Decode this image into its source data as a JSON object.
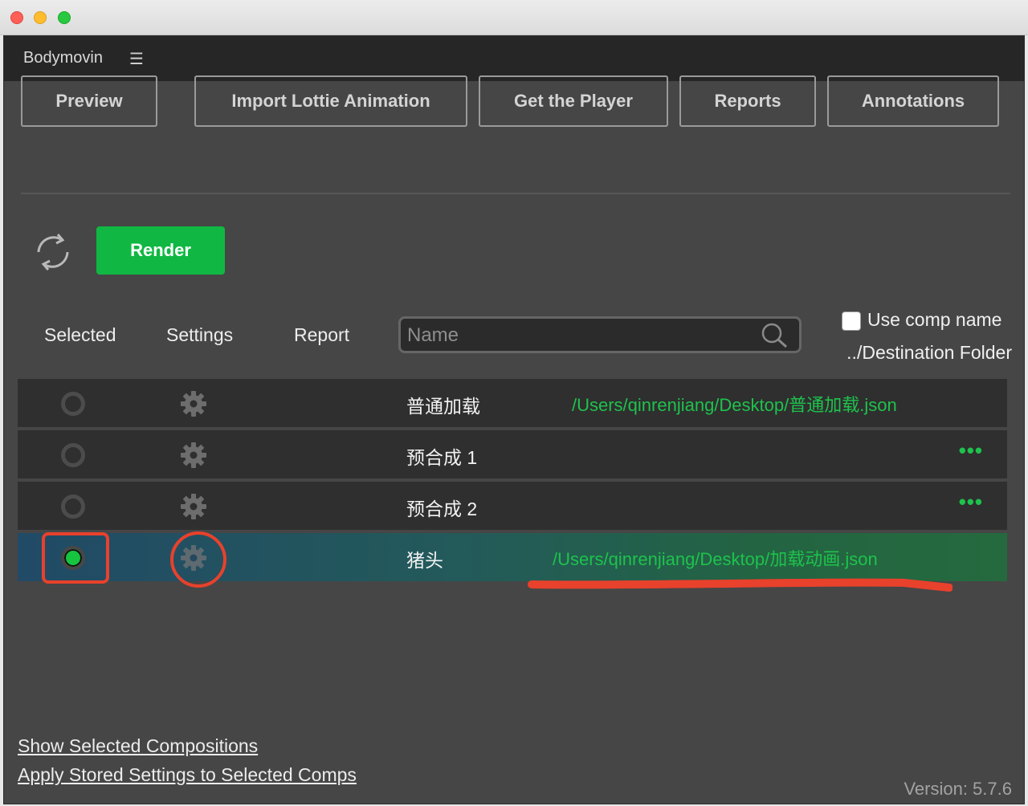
{
  "panel": {
    "title": "Bodymovin",
    "menu_icon": "hamburger-icon"
  },
  "nav": [
    "Preview",
    "Import Lottie Animation",
    "Get the Player",
    "Reports",
    "Annotations"
  ],
  "render_label": "Render",
  "columns": {
    "selected": "Selected",
    "settings": "Settings",
    "report": "Report"
  },
  "search": {
    "placeholder": "Name",
    "value": ""
  },
  "use_comp_name": {
    "label": "Use comp name",
    "checked": false
  },
  "destination_label": "../Destination Folder",
  "comps": [
    {
      "name": "普通加载",
      "path": "/Users/qinrenjiang/Desktop/普通加载.json",
      "selected": false
    },
    {
      "name": "预合成 1",
      "path": "",
      "more": "•••",
      "selected": false
    },
    {
      "name": "预合成 2",
      "path": "",
      "more": "•••",
      "selected": false
    },
    {
      "name": "猪头",
      "path": "/Users/qinrenjiang/Desktop/加载动画.json",
      "selected": true
    }
  ],
  "links": {
    "show_selected": "Show Selected Compositions",
    "apply_stored": "Apply Stored Settings to Selected Comps"
  },
  "version": "Version: 5.7.6",
  "colors": {
    "accent_green": "#10b843",
    "path_green": "#1ec24c",
    "annotation_red": "#e8412c"
  }
}
